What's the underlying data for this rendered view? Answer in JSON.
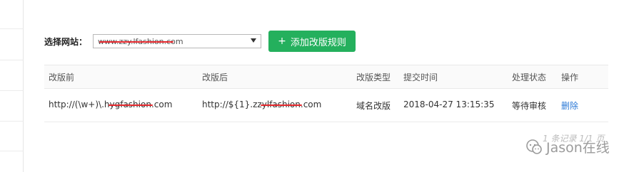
{
  "filter": {
    "label": "选择网站：",
    "selected_site": "www.zzy.lfashion.com"
  },
  "buttons": {
    "add_rule": "添加改版规则"
  },
  "table": {
    "headers": [
      "改版前",
      "改版后",
      "改版类型",
      "提交时间",
      "处理状态",
      "操作"
    ],
    "rows": [
      {
        "before": "http://(\\w+)\\.h",
        "before_redacted": "ygfashion",
        "before_suffix": ".com",
        "after": "http://${1}.zz",
        "after_redacted": "ylfashion",
        "after_suffix": ".com",
        "type": "域名改版",
        "time": "2018-04-27 13:15:35",
        "status": "等待审核",
        "action": "删除"
      }
    ]
  },
  "pager": "1 条记录 1/1 页",
  "watermark": "Jason在线",
  "colors": {
    "accent_green": "#24b05d",
    "link_blue": "#2b79d6",
    "redaction_red": "#e3262b"
  },
  "icons": {
    "add": "plus-icon",
    "dropdown": "chevron-down-icon",
    "watermark": "wechat-icon"
  }
}
